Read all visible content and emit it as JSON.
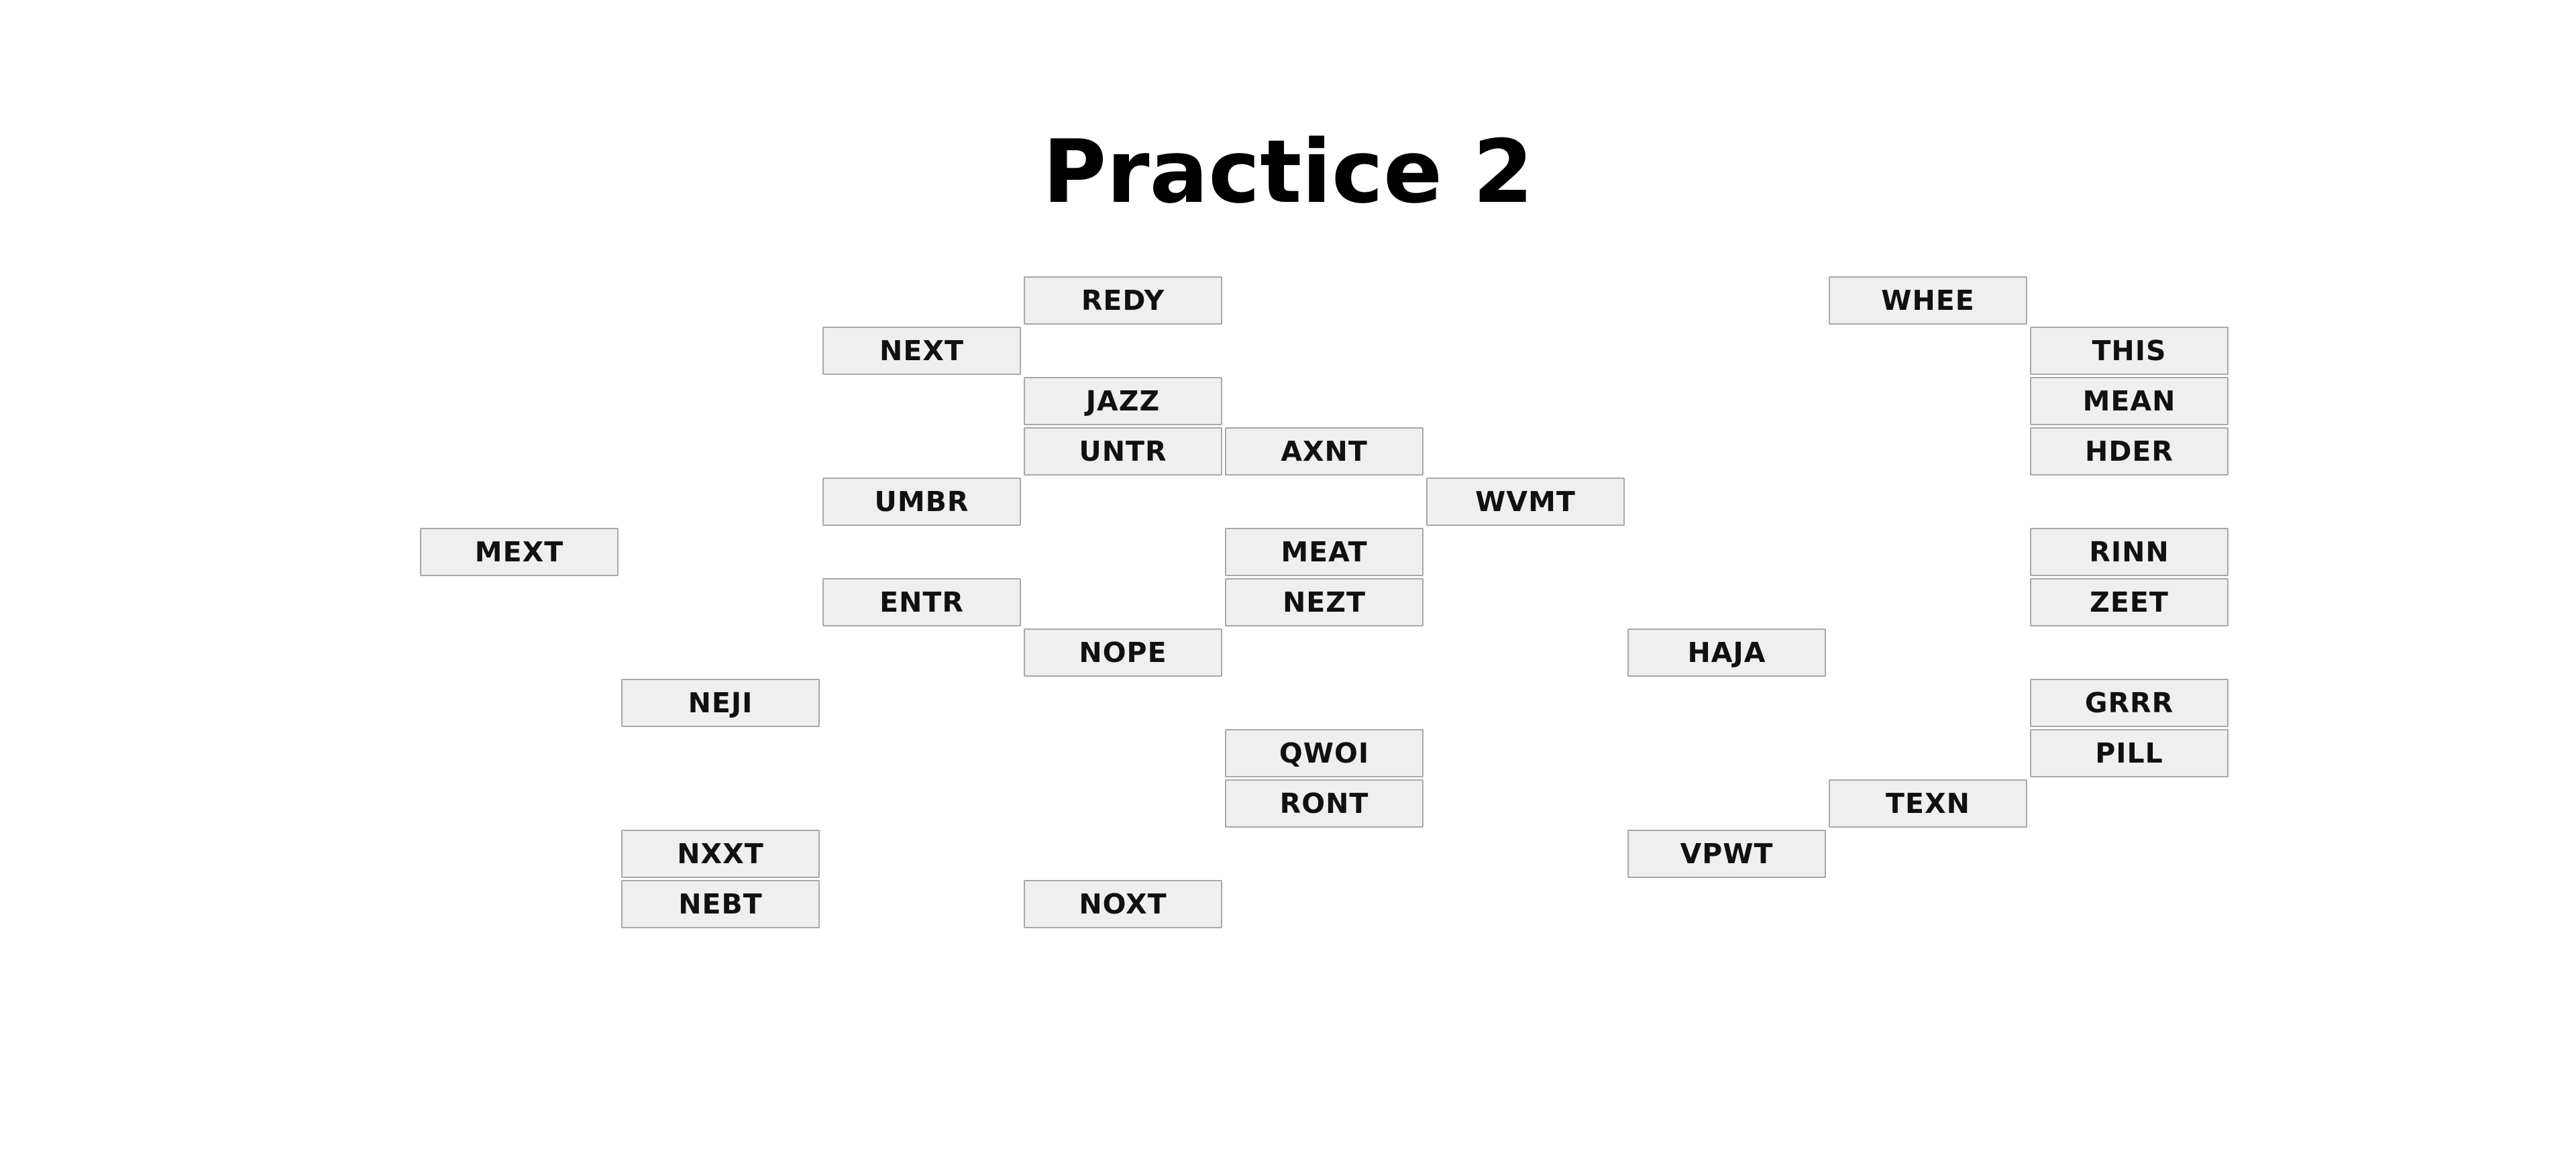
{
  "page": {
    "title": "Practice 2"
  },
  "words": [
    {
      "label": "REDY"
    },
    {
      "label": "NEXT"
    },
    {
      "label": "JAZZ"
    },
    {
      "label": "UNTR"
    },
    {
      "label": "AXNT"
    },
    {
      "label": "UMBR"
    },
    {
      "label": "WVMT"
    },
    {
      "label": "MEXT"
    },
    {
      "label": "MEAT"
    },
    {
      "label": "ENTR"
    },
    {
      "label": "NEZT"
    },
    {
      "label": "NOPE"
    },
    {
      "label": "NEJI"
    },
    {
      "label": "QWOI"
    },
    {
      "label": "RONT"
    },
    {
      "label": "NXXT"
    },
    {
      "label": "NEBT"
    },
    {
      "label": "NOXT"
    },
    {
      "label": "WHEE"
    },
    {
      "label": "THIS"
    },
    {
      "label": "MEAN"
    },
    {
      "label": "HDER"
    },
    {
      "label": "RINN"
    },
    {
      "label": "ZEET"
    },
    {
      "label": "HAJA"
    },
    {
      "label": "GRRR"
    },
    {
      "label": "PILL"
    },
    {
      "label": "TEXN"
    },
    {
      "label": "VPWT"
    }
  ]
}
